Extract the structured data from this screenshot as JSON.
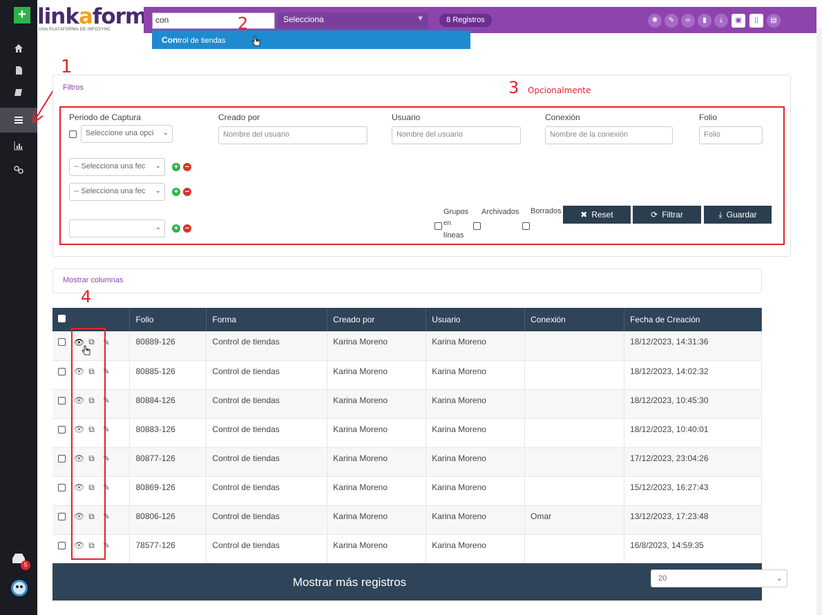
{
  "brand": {
    "name_a": "link",
    "name_o": "a",
    "name_b": "form",
    "tagline": "UNA PLATAFORMA DE INFOSYNC"
  },
  "sidebar": {
    "add_label": "+",
    "items": [
      {
        "icon": "home-icon"
      },
      {
        "icon": "document-icon"
      },
      {
        "icon": "book-icon"
      },
      {
        "icon": "list-icon"
      },
      {
        "icon": "chart-icon"
      },
      {
        "icon": "link-icon"
      }
    ],
    "badge_count": "5"
  },
  "topbar": {
    "search_value": "con",
    "select_label": "Selecciona",
    "records_badge": "8 Registros",
    "actions": [
      "settings-icon",
      "edit-icon",
      "binoculars-icon",
      "file-icon",
      "download-icon",
      "archive-icon",
      "map-icon",
      "trash-icon"
    ]
  },
  "dropdown": {
    "match": "Con",
    "rest": "trol de tiendas"
  },
  "annotations": {
    "a1": "1",
    "a2": "2",
    "a3": "3",
    "a3_text": "Opcionalmente",
    "a4": "4"
  },
  "filters": {
    "title": "Filtros",
    "periodo_label": "Periodo de Captura",
    "periodo_select": "Seleccione una opci",
    "creado_label": "Creado por",
    "creado_placeholder": "Nombre del usuario",
    "usuario_label": "Usuario",
    "usuario_placeholder": "Nombre del usuario",
    "conexion_label": "Conexión",
    "conexion_placeholder": "Nombre de la conexión",
    "folio_label": "Folio",
    "folio_placeholder": "Folio",
    "fecha_select_1": "-- Selecciona una fec",
    "fecha_select_2": "-- Selecciona una fec",
    "fecha_select_3": "",
    "grupos_label": "Grupos",
    "en_lineas_label_1": "en",
    "en_lineas_label_2": "líneas",
    "archivados_label": "Archivados",
    "borrados_label": "Borrados",
    "reset_label": "Reset",
    "filtrar_label": "Filtrar",
    "guardar_label": "Guardar"
  },
  "columns_panel": {
    "title": "Mostrar columnas"
  },
  "table": {
    "headers": [
      "Folio",
      "Forma",
      "Creado por",
      "Usuario",
      "Conexión",
      "Fecha de Creación"
    ],
    "rows": [
      {
        "folio": "80889-126",
        "forma": "Control de tiendas",
        "creado": "Karina Moreno",
        "usuario": "Karina Moreno",
        "conexion": "",
        "fecha": "18/12/2023, 14:31:36"
      },
      {
        "folio": "80885-126",
        "forma": "Control de tiendas",
        "creado": "Karina Moreno",
        "usuario": "Karina Moreno",
        "conexion": "",
        "fecha": "18/12/2023, 14:02:32"
      },
      {
        "folio": "80884-126",
        "forma": "Control de tiendas",
        "creado": "Karina Moreno",
        "usuario": "Karina Moreno",
        "conexion": "",
        "fecha": "18/12/2023, 10:45:30"
      },
      {
        "folio": "80883-126",
        "forma": "Control de tiendas",
        "creado": "Karina Moreno",
        "usuario": "Karina Moreno",
        "conexion": "",
        "fecha": "18/12/2023, 10:40:01"
      },
      {
        "folio": "80877-126",
        "forma": "Control de tiendas",
        "creado": "Karina Moreno",
        "usuario": "Karina Moreno",
        "conexion": "",
        "fecha": "17/12/2023, 23:04:26"
      },
      {
        "folio": "80869-126",
        "forma": "Control de tiendas",
        "creado": "Karina Moreno",
        "usuario": "Karina Moreno",
        "conexion": "",
        "fecha": "15/12/2023, 16:27:43"
      },
      {
        "folio": "80806-126",
        "forma": "Control de tiendas",
        "creado": "Karina Moreno",
        "usuario": "Karina Moreno",
        "conexion": "Omar",
        "fecha": "13/12/2023, 17:23:48"
      },
      {
        "folio": "78577-126",
        "forma": "Control de tiendas",
        "creado": "Karina Moreno",
        "usuario": "Karina Moreno",
        "conexion": "",
        "fecha": "16/8/2023, 14:59:35"
      }
    ]
  },
  "footer": {
    "more_label": "Mostrar más registros",
    "page_size": "20"
  },
  "colors": {
    "accent": "#8e44ad",
    "header": "#2f4458",
    "annotation": "#e0242b",
    "plus": "#2db24a",
    "minus": "#d9362c"
  }
}
